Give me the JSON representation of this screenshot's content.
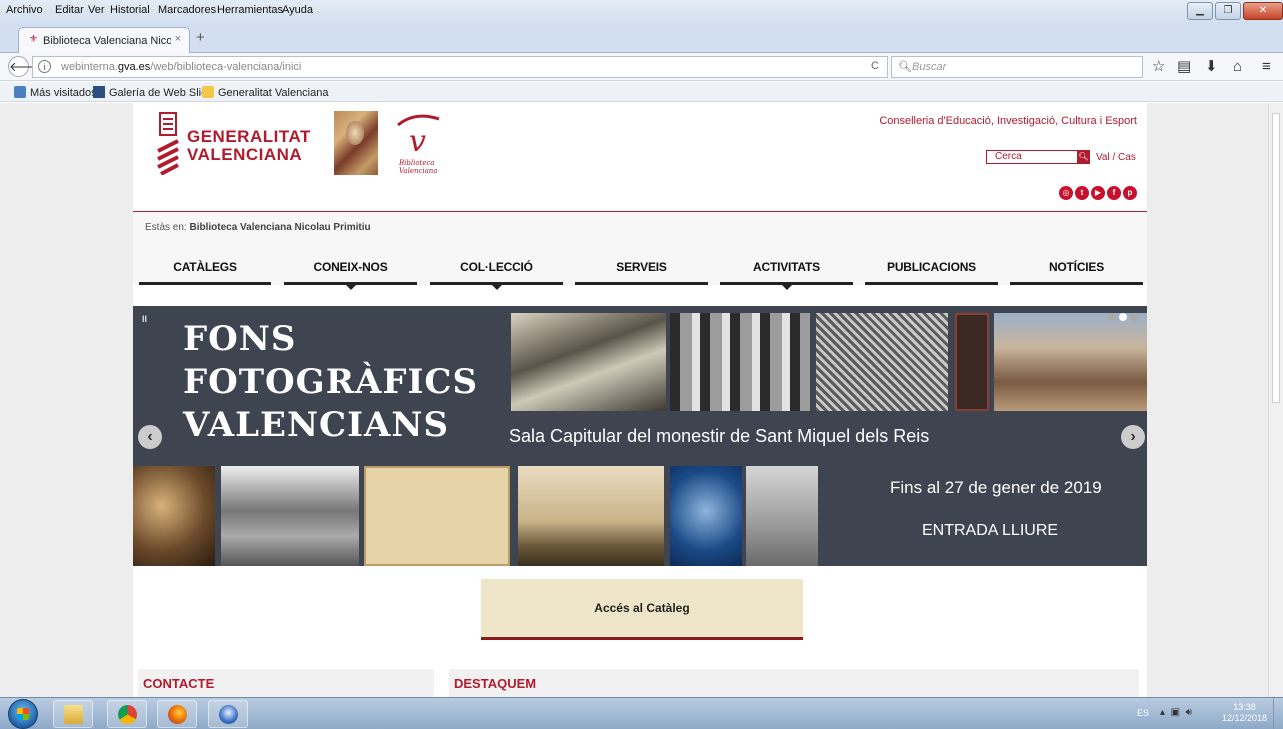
{
  "menubar": {
    "items": [
      "Archivo",
      "Editar",
      "Ver",
      "Historial",
      "Marcadores",
      "Herramientas",
      "Ayuda"
    ]
  },
  "browser": {
    "tab_title": "Biblioteca Valenciana Nicol...",
    "tab_close": "×",
    "new_tab": "+",
    "url_prefix": "webinterna.",
    "url_domain": "gva.es",
    "url_path": "/web/biblioteca-valenciana/inici",
    "search_placeholder": "Buscar",
    "bookmarks": [
      "Más visitados",
      "Galería de Web Slice",
      "Generalitat Valenciana"
    ]
  },
  "header": {
    "gv_line1": "GENERALITAT",
    "gv_line2": "VALENCIANA",
    "bv_line1": "Biblioteca",
    "bv_line2": "Valenciana",
    "conselleria": "Conselleria d'Educació, Investigació, Cultura i Esport",
    "search_label": "Cerca",
    "lang": "Val / Cas",
    "social_icons": [
      "instagram-icon",
      "twitter-icon",
      "youtube-icon",
      "facebook-icon",
      "pinterest-icon"
    ]
  },
  "breadcrumb": {
    "prefix": "Estàs en:",
    "current": "Biblioteca Valenciana Nicolau Primitiu"
  },
  "nav": {
    "items": [
      {
        "label": "CATÀLEGS",
        "has_dropdown": false
      },
      {
        "label": "CONEIX-NOS",
        "has_dropdown": true
      },
      {
        "label": "COL·LECCIÓ",
        "has_dropdown": true
      },
      {
        "label": "SERVEIS",
        "has_dropdown": false
      },
      {
        "label": "ACTIVITATS",
        "has_dropdown": true
      },
      {
        "label": "PUBLICACIONS",
        "has_dropdown": false
      },
      {
        "label": "NOTÍCIES",
        "has_dropdown": false
      }
    ]
  },
  "banner": {
    "title_line1": "FONS",
    "title_line2": "FOTOGRÀFICS",
    "title_line3": "VALENCIANS",
    "subtitle": "Sala Capitular del monestir de Sant Miquel dels Reis",
    "dates": "Fins al 27 de gener de 2019",
    "entry": "ENTRADA LLIURE",
    "slide_count": 3,
    "active_slide": 2
  },
  "catalog_button": "Accés al Catàleg",
  "sections": {
    "contacte": "CONTACTE",
    "destaquem": "DESTAQUEM"
  },
  "taskbar": {
    "lang": "ES",
    "time": "13:38",
    "date": "12/12/2018"
  },
  "colors": {
    "brand_red": "#b01c2e",
    "banner_bg": "#3e4550",
    "catalog_bg": "#efe6c9"
  }
}
